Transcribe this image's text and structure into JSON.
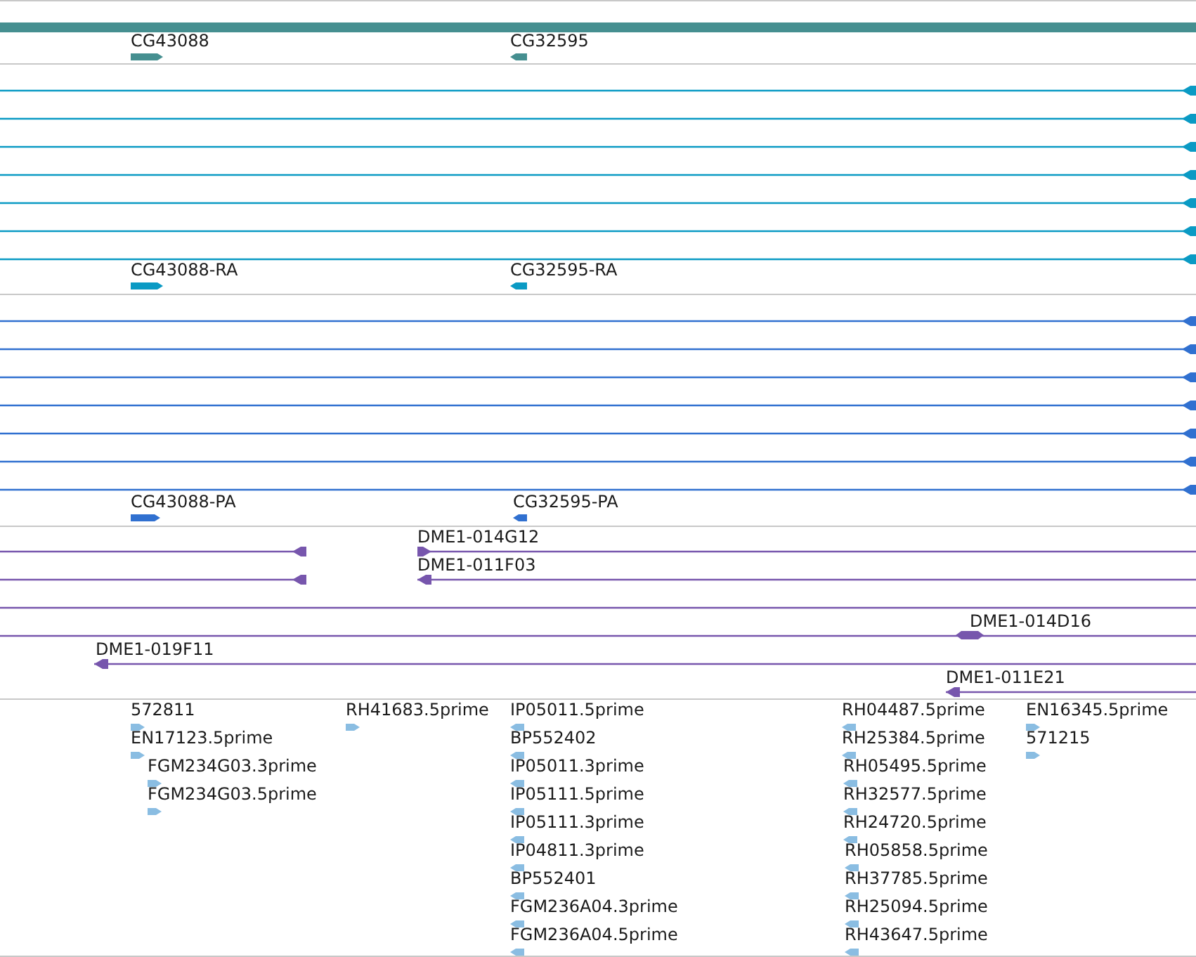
{
  "tracks": [
    {
      "kind": "gene",
      "features": [
        {
          "label": "CG43088",
          "reverse": false
        },
        {
          "label": "CG32595",
          "reverse": true
        }
      ]
    },
    {
      "kind": "transcript",
      "lines": [
        {
          "reverse": true
        },
        {
          "reverse": true
        },
        {
          "reverse": true
        },
        {
          "reverse": true
        },
        {
          "reverse": true
        },
        {
          "reverse": true
        },
        {
          "reverse": true
        }
      ],
      "features": [
        {
          "label": "CG43088-RA",
          "reverse": false
        },
        {
          "label": "CG32595-RA",
          "reverse": true
        }
      ]
    },
    {
      "kind": "protein",
      "lines": [
        {
          "reverse": true
        },
        {
          "reverse": true
        },
        {
          "reverse": true
        },
        {
          "reverse": true
        },
        {
          "reverse": true
        },
        {
          "reverse": true
        },
        {
          "reverse": true
        }
      ],
      "features": [
        {
          "label": "CG43088-PA",
          "reverse": false
        },
        {
          "label": "CG32595-PA",
          "reverse": true
        }
      ]
    },
    {
      "kind": "clone",
      "features": [
        {
          "kind": "arrow",
          "reverse": true
        },
        {
          "kind": "arrow",
          "label": "DME1-014G12",
          "reverse": false
        },
        {
          "kind": "arrow",
          "reverse": true
        },
        {
          "kind": "arrow",
          "label": "DME1-011F03",
          "reverse": true
        },
        {
          "kind": "plain"
        },
        {
          "kind": "oval",
          "label": "DME1-014D16"
        },
        {
          "kind": "arrow",
          "label": "DME1-019F11",
          "reverse": true
        },
        {
          "kind": "arrow",
          "label": "DME1-011E21",
          "reverse": true
        }
      ]
    },
    {
      "kind": "est",
      "features": [
        {
          "label": "572811",
          "reverse": false
        },
        {
          "label": "EN17123.5prime",
          "reverse": false
        },
        {
          "label": "FGM234G03.3prime",
          "reverse": false
        },
        {
          "label": "FGM234G03.5prime",
          "reverse": false
        },
        {
          "label": "RH41683.5prime",
          "reverse": false
        },
        {
          "label": "IP05011.5prime",
          "reverse": true
        },
        {
          "label": "BP552402",
          "reverse": true
        },
        {
          "label": "IP05011.3prime",
          "reverse": true
        },
        {
          "label": "IP05111.5prime",
          "reverse": true
        },
        {
          "label": "IP05111.3prime",
          "reverse": true
        },
        {
          "label": "IP04811.3prime",
          "reverse": true
        },
        {
          "label": "BP552401",
          "reverse": true
        },
        {
          "label": "FGM236A04.3prime",
          "reverse": true
        },
        {
          "label": "FGM236A04.5prime",
          "reverse": true
        },
        {
          "label": "RH04487.5prime",
          "reverse": true
        },
        {
          "label": "RH25384.5prime",
          "reverse": true
        },
        {
          "label": "RH05495.5prime",
          "reverse": true
        },
        {
          "label": "RH32577.5prime",
          "reverse": true
        },
        {
          "label": "RH24720.5prime",
          "reverse": true
        },
        {
          "label": "RH05858.5prime",
          "reverse": true
        },
        {
          "label": "RH37785.5prime",
          "reverse": true
        },
        {
          "label": "RH25094.5prime",
          "reverse": true
        },
        {
          "label": "RH43647.5prime",
          "reverse": true
        },
        {
          "label": "EN16345.5prime",
          "reverse": false
        },
        {
          "label": "571215",
          "reverse": false
        }
      ]
    }
  ]
}
